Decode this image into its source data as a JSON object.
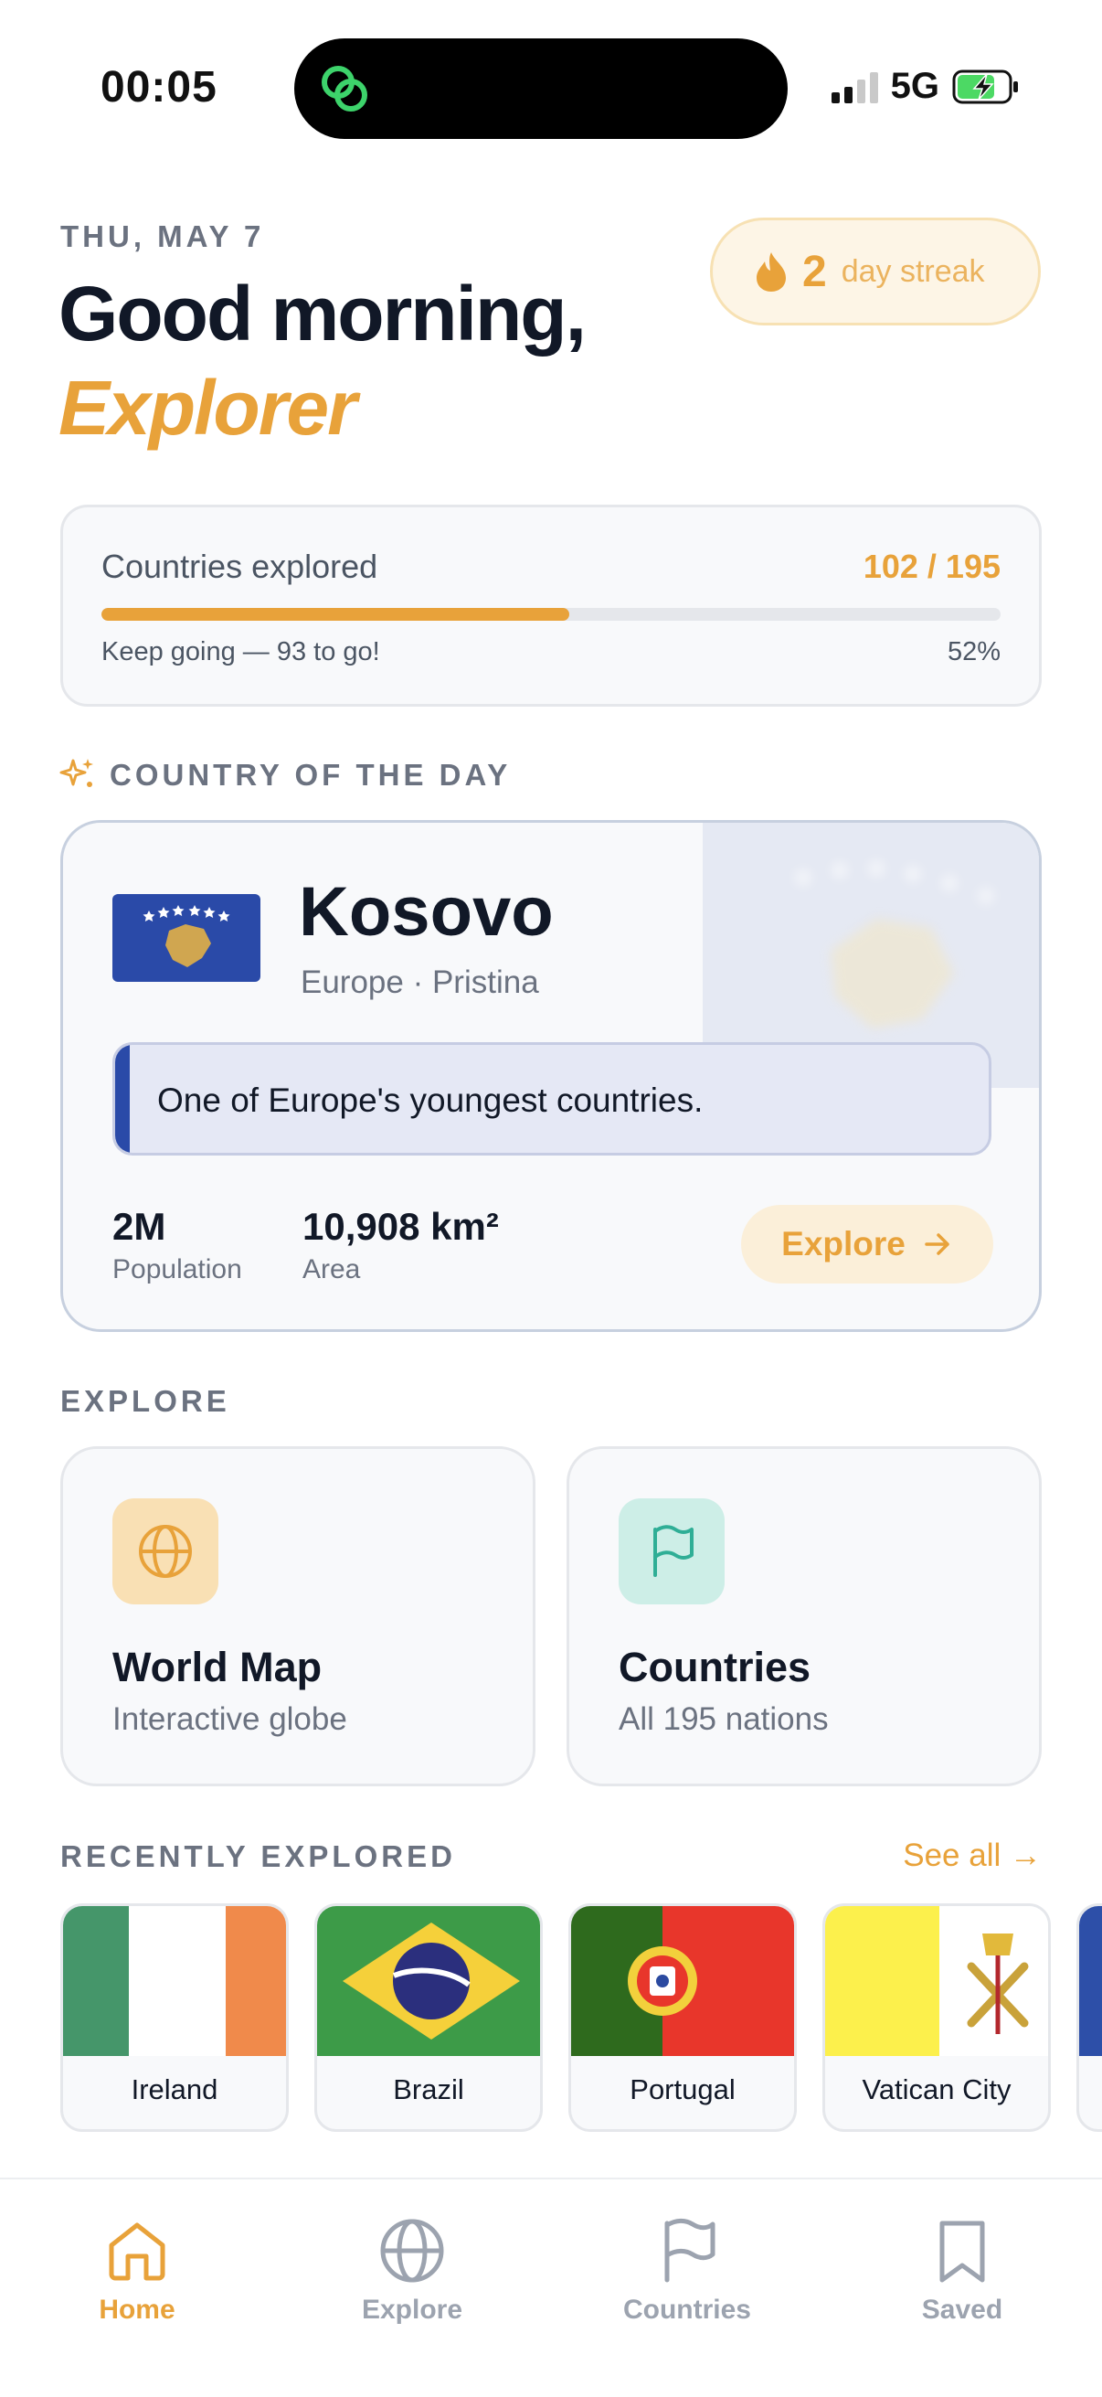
{
  "status_bar": {
    "time": "00:05",
    "network": "5G"
  },
  "header": {
    "date": "THU, MAY 7",
    "greeting": "Good morning,",
    "name": "Explorer",
    "streak": {
      "count": "2",
      "label": "day streak"
    }
  },
  "progress": {
    "label": "Countries explored",
    "count": "102 / 195",
    "fraction": 0.52,
    "subtitle": "Keep going — 93 to go!",
    "percent": "52%"
  },
  "country_of_day": {
    "section_title": "COUNTRY OF THE DAY",
    "name": "Kosovo",
    "subtitle": "Europe · Pristina",
    "fact": "One of Europe's youngest countries.",
    "population_value": "2M",
    "population_label": "Population",
    "area_value": "10,908 km²",
    "area_label": "Area",
    "explore_label": "Explore"
  },
  "explore": {
    "section_title": "EXPLORE",
    "tiles": [
      {
        "title": "World Map",
        "subtitle": "Interactive globe",
        "icon": "globe-icon"
      },
      {
        "title": "Countries",
        "subtitle": "All 195 nations",
        "icon": "flag-icon"
      }
    ]
  },
  "recent": {
    "section_title": "RECENTLY EXPLORED",
    "see_all": "See all →",
    "items": [
      {
        "name": "Ireland"
      },
      {
        "name": "Brazil"
      },
      {
        "name": "Portugal"
      },
      {
        "name": "Vatican City"
      }
    ]
  },
  "nav": {
    "items": [
      {
        "label": "Home",
        "icon": "home-icon",
        "active": true
      },
      {
        "label": "Explore",
        "icon": "globe-icon",
        "active": false
      },
      {
        "label": "Countries",
        "icon": "flag-icon",
        "active": false
      },
      {
        "label": "Saved",
        "icon": "bookmark-icon",
        "active": false
      }
    ]
  },
  "colors": {
    "accent": "#e8a23a",
    "text": "#111827",
    "muted": "#6b7280",
    "kosovo_blue": "#2a4aa8",
    "kosovo_gold": "#d0a650"
  }
}
